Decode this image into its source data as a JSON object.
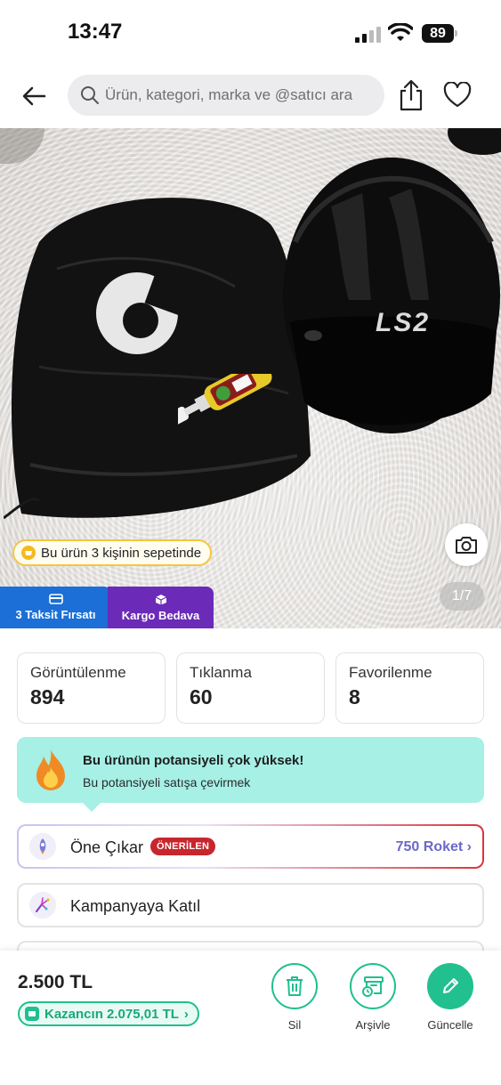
{
  "status": {
    "time": "13:47",
    "battery": "89"
  },
  "nav": {
    "search_placeholder": "Ürün, kategori, marka ve @satıcı ara"
  },
  "hero": {
    "basket_text": "Bu ürün 3 kişinin sepetinde",
    "pager": "1/7",
    "badges": [
      {
        "label": "3 Taksit Fırsatı",
        "icon": "card-icon"
      },
      {
        "label": "Kargo Bedava",
        "icon": "box-icon"
      }
    ]
  },
  "stats": [
    {
      "label": "Görüntülenme",
      "value": "894"
    },
    {
      "label": "Tıklanma",
      "value": "60"
    },
    {
      "label": "Favorilenme",
      "value": "8"
    }
  ],
  "potential": {
    "title": "Bu ürünün potansiyeli çok yüksek!",
    "subtitle": "Bu potansiyeli satışa çevirmek"
  },
  "promote": {
    "label": "Öne Çıkar",
    "tag": "ÖNERİLEN",
    "cost": "750 Roket"
  },
  "campaign": {
    "label": "Kampanyaya Katıl"
  },
  "bottom": {
    "price": "2.500 TL",
    "earn": "Kazancın 2.075,01 TL",
    "actions": [
      {
        "label": "Sil",
        "icon": "trash-icon"
      },
      {
        "label": "Arşivle",
        "icon": "archive-icon"
      },
      {
        "label": "Güncelle",
        "icon": "pencil-icon"
      }
    ]
  },
  "colors": {
    "accent": "#1fbf8f",
    "potential_bg": "#a6f0e6",
    "tag": "#c8262d",
    "roket": "#6b69c6",
    "taksit": "#1b6fd6",
    "kargo": "#6b2bb8"
  }
}
